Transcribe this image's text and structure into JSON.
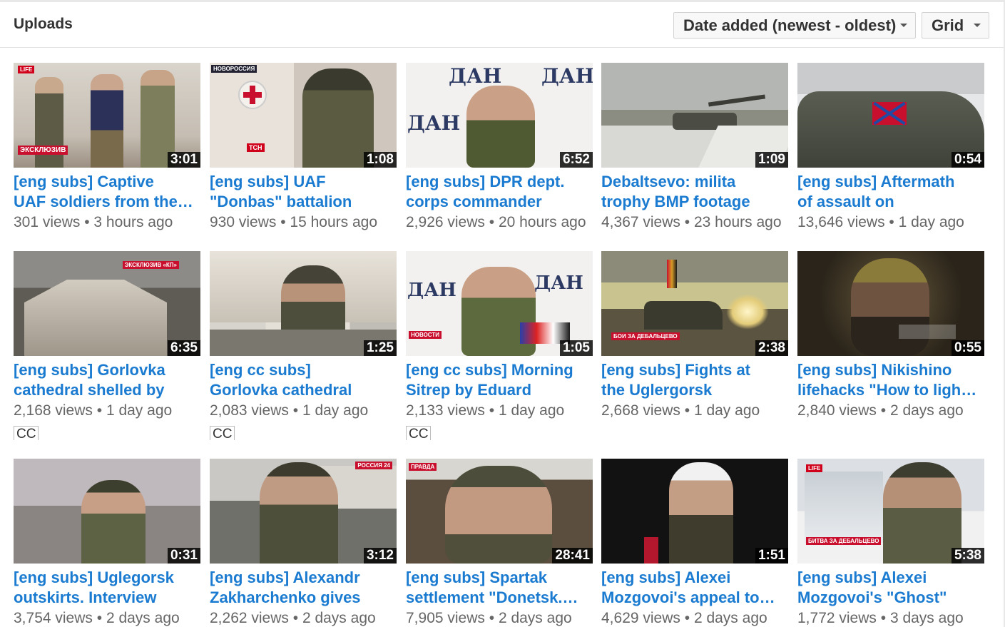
{
  "header": {
    "title": "Uploads",
    "sort_label": "Date added (newest - oldest)",
    "view_label": "Grid"
  },
  "videos": [
    {
      "title1": "[eng subs] Captive",
      "title2": "UAF soldiers from the…",
      "views": "301 views",
      "age": "3 hours ago",
      "duration": "3:01",
      "cc": ""
    },
    {
      "title1": "[eng subs] UAF",
      "title2": "\"Donbas\" battalion",
      "views": "930 views",
      "age": "15 hours ago",
      "duration": "1:08",
      "cc": ""
    },
    {
      "title1": "[eng subs] DPR dept.",
      "title2": "corps commander",
      "views": "2,926 views",
      "age": "20 hours ago",
      "duration": "6:52",
      "cc": ""
    },
    {
      "title1": "Debaltsevo: milita",
      "title2": "trophy BMP footage",
      "views": "4,367 views",
      "age": "23 hours ago",
      "duration": "1:09",
      "cc": ""
    },
    {
      "title1": "[eng subs] Aftermath",
      "title2": "of assault on",
      "views": "13,646 views",
      "age": "1 day ago",
      "duration": "0:54",
      "cc": ""
    },
    {
      "title1": "[eng subs] Gorlovka",
      "title2": "cathedral shelled by",
      "views": "2,168 views",
      "age": "1 day ago",
      "duration": "6:35",
      "cc": "CC"
    },
    {
      "title1": "[eng cc subs]",
      "title2": "Gorlovka cathedral",
      "views": "2,083 views",
      "age": "1 day ago",
      "duration": "1:25",
      "cc": "CC"
    },
    {
      "title1": "[eng cc subs] Morning",
      "title2": "Sitrep by Eduard",
      "views": "2,133 views",
      "age": "1 day ago",
      "duration": "1:05",
      "cc": "CC"
    },
    {
      "title1": "[eng subs] Fights at",
      "title2": "the Uglergorsk",
      "views": "2,668 views",
      "age": "1 day ago",
      "duration": "2:38",
      "cc": ""
    },
    {
      "title1": "[eng subs] Nikishino",
      "title2": "lifehacks \"How to ligh…",
      "views": "2,840 views",
      "age": "2 days ago",
      "duration": "0:55",
      "cc": ""
    },
    {
      "title1": "[eng subs] Uglegorsk",
      "title2": "outskirts. Interview",
      "views": "3,754 views",
      "age": "2 days ago",
      "duration": "0:31",
      "cc": ""
    },
    {
      "title1": "[eng subs] Alexandr",
      "title2": "Zakharchenko gives",
      "views": "2,262 views",
      "age": "2 days ago",
      "duration": "3:12",
      "cc": ""
    },
    {
      "title1": "[eng subs] Spartak",
      "title2": "settlement \"Donetsk.…",
      "views": "7,905 views",
      "age": "2 days ago",
      "duration": "28:41",
      "cc": ""
    },
    {
      "title1": "[eng subs] Alexei",
      "title2": "Mozgovoi's appeal to…",
      "views": "4,629 views",
      "age": "2 days ago",
      "duration": "1:51",
      "cc": ""
    },
    {
      "title1": "[eng subs] Alexei",
      "title2": "Mozgovoi's \"Ghost\"",
      "views": "1,772 views",
      "age": "3 days ago",
      "duration": "5:38",
      "cc": ""
    }
  ],
  "colors": {
    "link": "#1b7bd0",
    "meta": "#666666"
  }
}
